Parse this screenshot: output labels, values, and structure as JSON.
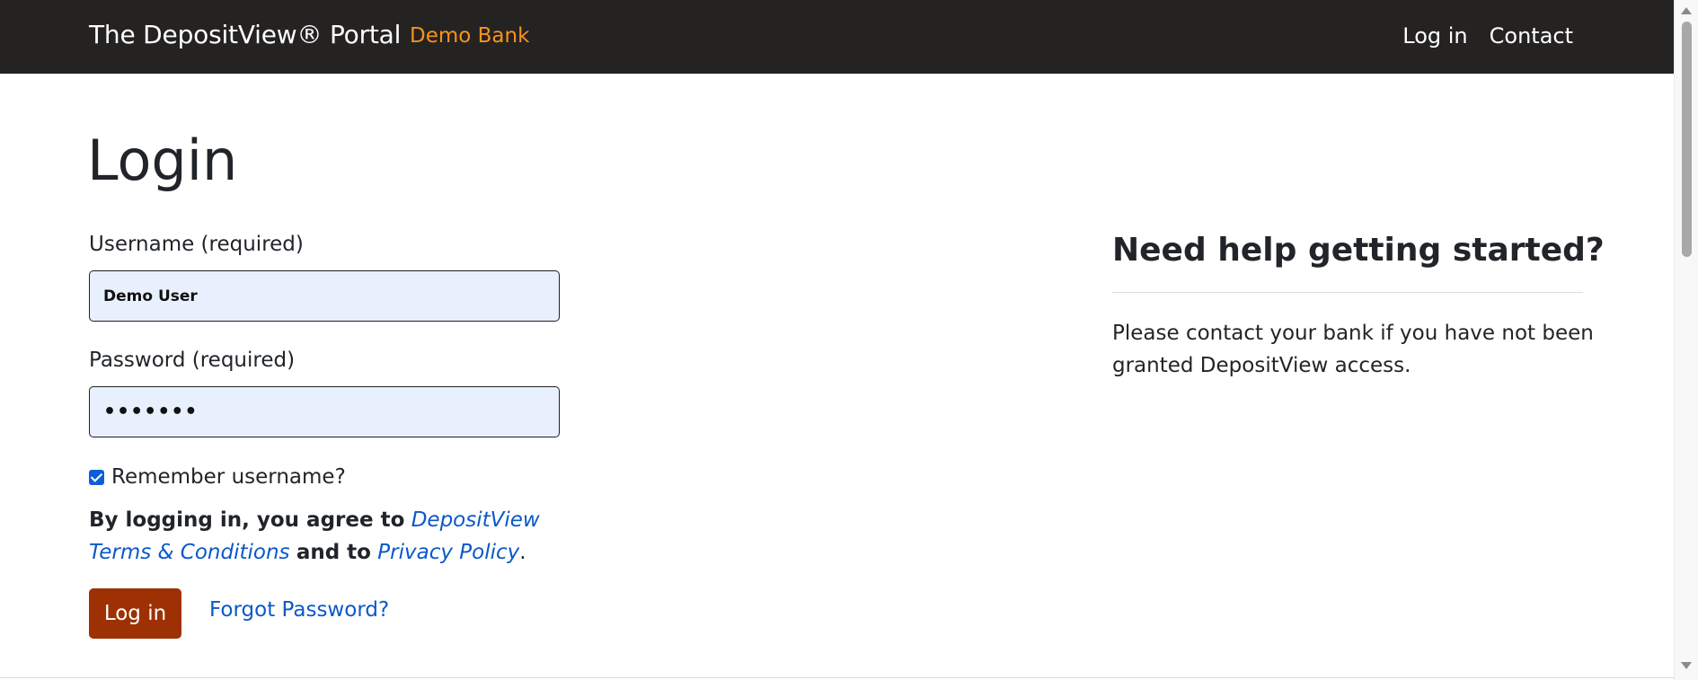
{
  "navbar": {
    "brand": "The DepositView® Portal",
    "bank_name": "Demo Bank",
    "links": {
      "login": "Log in",
      "contact": "Contact"
    }
  },
  "login": {
    "title": "Login",
    "username_label": "Username (required)",
    "username_value": "Demo User",
    "password_label": "Password (required)",
    "password_value": "•••••••",
    "remember_label": "Remember username?",
    "remember_checked": true,
    "agreement_prefix": "By logging in, you agree to",
    "terms_link": "DepositView Terms & Conditions",
    "agreement_middle": "and to",
    "privacy_link": "Privacy Policy",
    "agreement_suffix": ".",
    "submit_label": "Log in",
    "forgot_label": "Forgot Password?"
  },
  "help": {
    "title": "Need help getting started?",
    "text": "Please contact your bank if you have not been granted DepositView access."
  },
  "colors": {
    "navbar_bg": "#252222",
    "bank_accent": "#f7931e",
    "button_bg": "#9e3103",
    "link": "#0a58ca",
    "input_bg": "#e8f0fe"
  }
}
